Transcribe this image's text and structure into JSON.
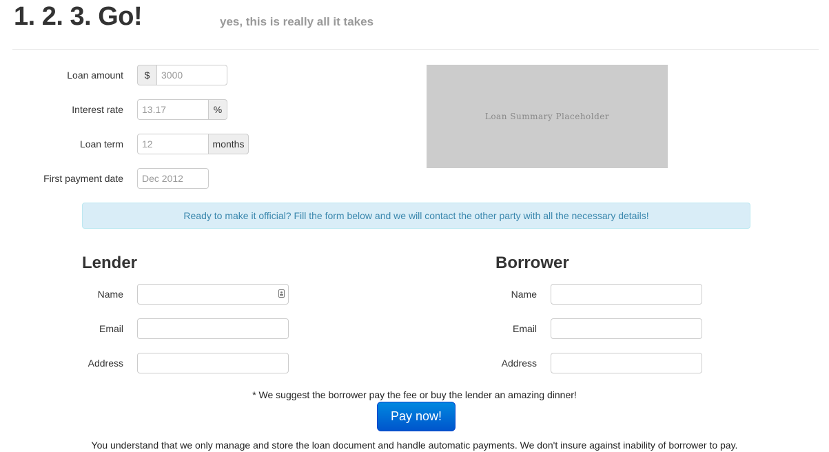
{
  "header": {
    "title": "1. 2. 3. Go!",
    "tagline": "yes, this is really all it takes"
  },
  "loan_form": {
    "amount": {
      "label": "Loan amount",
      "prefix": "$",
      "placeholder": "3000"
    },
    "rate": {
      "label": "Interest rate",
      "placeholder": "13.17",
      "suffix": "%"
    },
    "term": {
      "label": "Loan term",
      "placeholder": "12",
      "suffix": "months"
    },
    "first_payment": {
      "label": "First payment date",
      "placeholder": "Dec 2012"
    }
  },
  "summary": {
    "placeholder_text": "Loan Summary Placeholder"
  },
  "alert": {
    "text": "Ready to make it official? Fill the form below and we will contact the other party with all the necessary details!"
  },
  "lender": {
    "title": "Lender",
    "name_label": "Name",
    "email_label": "Email",
    "address_label": "Address"
  },
  "borrower": {
    "title": "Borrower",
    "name_label": "Name",
    "email_label": "Email",
    "address_label": "Address"
  },
  "footer": {
    "fee_note": "* We suggest the borrower pay the fee or buy the lender an amazing dinner!",
    "pay_button": "Pay now!",
    "disclaimer": "You understand that we only manage and store the loan document and handle automatic payments. We don't insure against inability of borrower to pay."
  },
  "colors": {
    "alert_bg": "#d9edf7",
    "alert_text": "#3a87ad",
    "button": "#0066dd",
    "placeholder_box": "#cccccc"
  }
}
